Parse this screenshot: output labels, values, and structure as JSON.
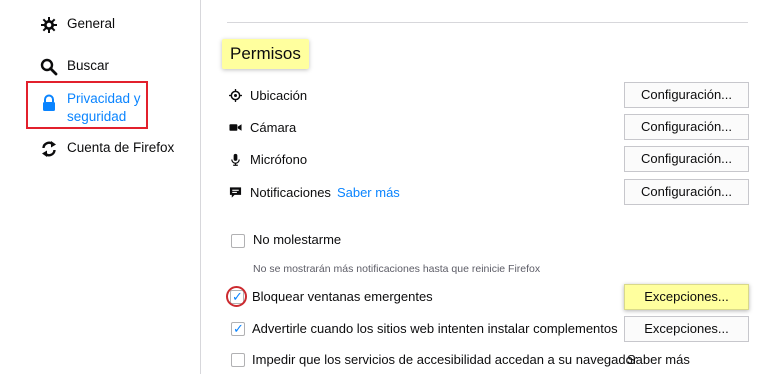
{
  "sidebar": {
    "items": [
      {
        "label": "General",
        "icon": "gear-icon"
      },
      {
        "label": "Buscar",
        "icon": "search-icon"
      },
      {
        "label_line1": "Privacidad y",
        "label_line2": "seguridad",
        "icon": "lock-icon",
        "selected": true
      },
      {
        "label": "Cuenta de Firefox",
        "icon": "sync-icon"
      }
    ]
  },
  "permissions": {
    "title": "Permisos",
    "rows": [
      {
        "label": "Ubicación",
        "icon": "location-icon",
        "button": "Configuración..."
      },
      {
        "label": "Cámara",
        "icon": "camera-icon",
        "button": "Configuración..."
      },
      {
        "label": "Micrófono",
        "icon": "microphone-icon",
        "button": "Configuración..."
      },
      {
        "label": "Notificaciones",
        "icon": "notification-icon",
        "link": "Saber más",
        "button": "Configuración..."
      }
    ],
    "checkboxes": [
      {
        "label": "No molestarme",
        "checked": false,
        "hint": "No se mostrarán más notificaciones hasta que reinicie Firefox"
      },
      {
        "label": "Bloquear ventanas emergentes",
        "checked": true,
        "button": "Excepciones..."
      },
      {
        "label": "Advertirle cuando los sitios web intenten instalar complementos",
        "checked": true,
        "button": "Excepciones..."
      },
      {
        "label": "Impedir que los servicios de accesibilidad accedan a su navegador",
        "checked": false,
        "link": "Saber más"
      }
    ]
  },
  "colors": {
    "accent": "#0a84ff",
    "highlight": "#ffff9e",
    "selection_outline": "#e2202c"
  }
}
